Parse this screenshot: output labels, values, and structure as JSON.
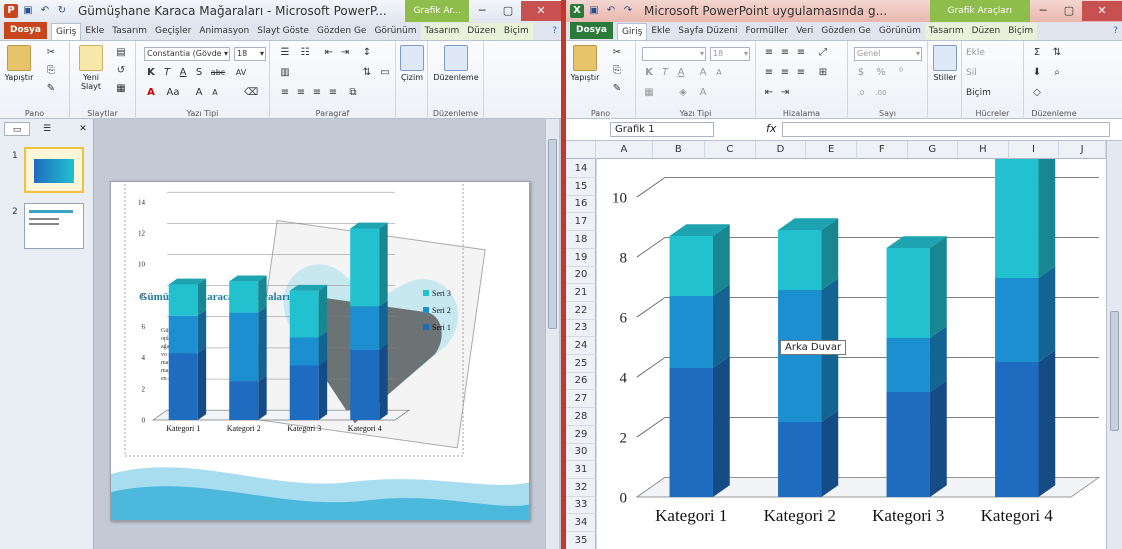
{
  "powerpoint": {
    "title": "Gümüşhane Karaca Mağaraları - Microsoft PowerP...",
    "contextual_tab": "Grafik Ar...",
    "tabs": [
      "Dosya",
      "Giriş",
      "Ekle",
      "Tasarım",
      "Geçişler",
      "Animasyon",
      "Slayt Göste",
      "Gözden Ge",
      "Görünüm",
      "Tasarım",
      "Düzen",
      "Biçim"
    ],
    "groups": {
      "pano": "Pano",
      "slaytlar": "Slaytlar",
      "yazi_tipi": "Yazı Tipi",
      "paragraf": "Paragraf",
      "cizim": "Çizim",
      "duzenleme": "Düzenleme"
    },
    "buttons": {
      "yapistir": "Yapıştır",
      "yeni_slayt": "Yeni Slayt",
      "cizim": "Çizim",
      "duzenleme": "Düzenleme"
    },
    "font_name": "Constantia (Gövde",
    "font_size": "18",
    "format_glyphs": [
      "K",
      "T",
      "A",
      "S",
      "abc",
      "AV"
    ],
    "slides": [
      "1",
      "2"
    ],
    "slide_text": {
      "title": "Gümüşhane Karaca Mağaraları",
      "body": [
        "Gümüşhane ilinin",
        "oplarında bulunan",
        "ağara",
        "vo mağ",
        "mavi",
        "mağaraları",
        "en"
      ]
    }
  },
  "excel": {
    "title": "Microsoft PowerPoint uygulamasında g...",
    "contextual_tab": "Grafik Araçları",
    "tabs": [
      "Dosya",
      "Giriş",
      "Ekle",
      "Sayfa Düzeni",
      "Formüller",
      "Veri",
      "Gözden Ge",
      "Görünüm",
      "Tasarım",
      "Düzen",
      "Biçim"
    ],
    "groups": {
      "pano": "Pano",
      "yazi_tipi": "Yazı Tipi",
      "hizalama": "Hizalama",
      "sayi": "Sayı",
      "hucreler": "Hücreler",
      "duzenleme": "Düzenleme"
    },
    "buttons": {
      "yapistir": "Yapıştır",
      "stiller": "Stiller",
      "ekle": "Ekle",
      "sil": "Sil",
      "bicim": "Biçim"
    },
    "font_size": "18",
    "number_format": "Genel",
    "name_box": "Grafik 1",
    "fx": "fx",
    "columns": [
      "A",
      "B",
      "C",
      "D",
      "E",
      "F",
      "G",
      "H",
      "I",
      "J"
    ],
    "rows": [
      "14",
      "15",
      "16",
      "17",
      "18",
      "19",
      "20",
      "21",
      "22",
      "23",
      "24",
      "25",
      "26",
      "27",
      "28",
      "29",
      "30",
      "31",
      "32",
      "33",
      "34",
      "35"
    ],
    "tooltip": "Arka Duvar"
  },
  "chart_data": [
    {
      "type": "bar",
      "stacked": true,
      "categories": [
        "Kategori 1",
        "Kategori 2",
        "Kategori 3",
        "Kategori 4"
      ],
      "series": [
        {
          "name": "Seri 1",
          "values": [
            4.3,
            2.5,
            3.5,
            4.5
          ],
          "color": "#1e6cc0"
        },
        {
          "name": "Seri 2",
          "values": [
            2.4,
            4.4,
            1.8,
            2.8
          ],
          "color": "#1b8fd0"
        },
        {
          "name": "Seri 3",
          "values": [
            2.0,
            2.0,
            3.0,
            5.0
          ],
          "color": "#22c1cf"
        }
      ],
      "yticks": [
        "0",
        "2",
        "4",
        "6",
        "8",
        "10",
        "12",
        "14"
      ],
      "ylim": [
        0,
        14
      ],
      "legend": "right"
    },
    {
      "type": "bar",
      "stacked": true,
      "categories": [
        "Kategori 1",
        "Kategori 2",
        "Kategori 3",
        "Kategori 4"
      ],
      "series": [
        {
          "values": [
            4.3,
            2.5,
            3.5,
            4.5
          ],
          "color": "#1e6cc0"
        },
        {
          "values": [
            2.4,
            4.4,
            1.8,
            2.8
          ],
          "color": "#1b8fd0"
        },
        {
          "values": [
            2.0,
            2.0,
            3.0,
            5.0
          ],
          "color": "#22c1cf"
        }
      ],
      "yticks": [
        "0",
        "2",
        "4",
        "6",
        "8",
        "10"
      ],
      "ylim": [
        0,
        10.6
      ],
      "grid": true
    }
  ]
}
